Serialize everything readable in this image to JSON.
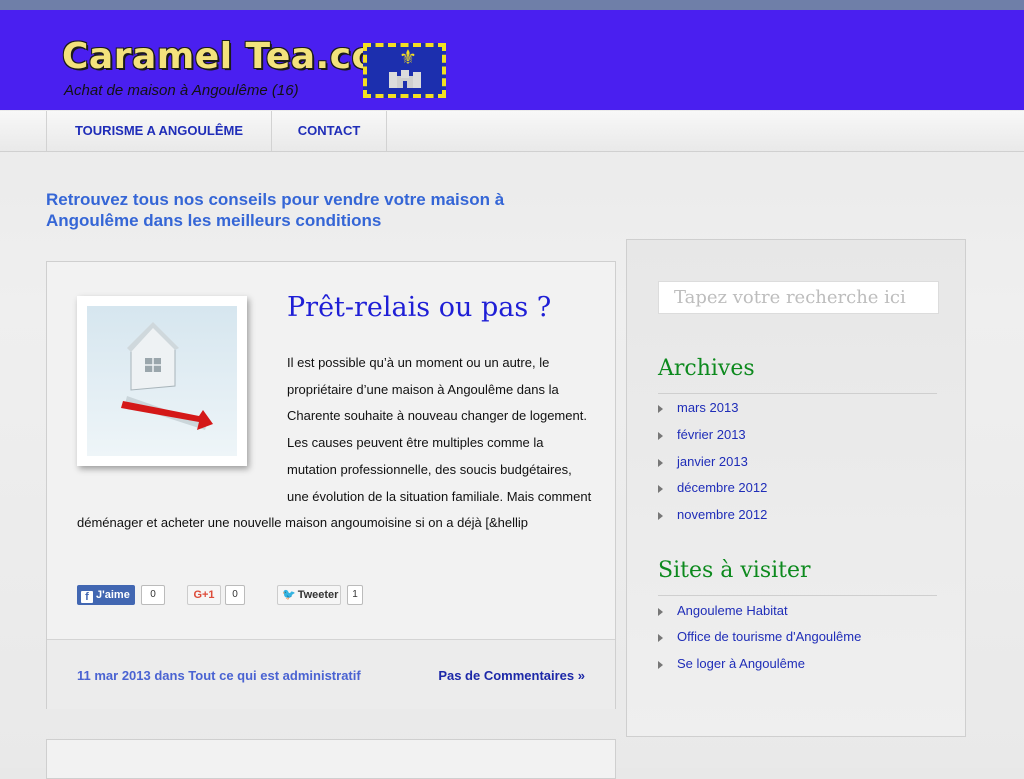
{
  "header": {
    "site_title": "Caramel Tea.com",
    "site_subtitle": "Achat de maison à Angoulême (16)",
    "flag_icon": "fleur-de-lis-castle-flag"
  },
  "nav": {
    "items": [
      "TOURISME A ANGOULÊME",
      "CONTACT"
    ]
  },
  "tagline": "Retrouvez tous nos conseils pour vendre votre maison à Angoulême dans les meilleurs conditions",
  "post": {
    "title": "Prêt-relais ou pas ?",
    "body": "Il est possible qu’à un moment ou un autre, le propriétaire d’une maison à Angoulême dans la Charente souhaite à nouveau changer de logement. Les causes peuvent être multiples comme la mutation professionnelle, des soucis budgétaires, une évolution de la situation familiale. Mais comment déménager et acheter une nouvelle maison angoumoisine si on a déjà [&hellip",
    "share": {
      "facebook_label": "J'aime",
      "facebook_count": "0",
      "gplus_label": "G+1",
      "gplus_count": "0",
      "twitter_label": "Tweeter",
      "twitter_count": "1"
    },
    "meta": "11 mar 2013 dans Tout ce qui est administratif",
    "comments": "Pas de Commentaires »"
  },
  "sidebar": {
    "search_placeholder": "Tapez votre recherche ici",
    "archives_title": "Archives",
    "archives": [
      "mars 2013",
      "février 2013",
      "janvier 2013",
      "décembre 2012",
      "novembre 2012"
    ],
    "sites_title": "Sites à visiter",
    "sites": [
      "Angouleme Habitat",
      "Office de tourisme d'Angoulême",
      "Se loger à Angoulême"
    ]
  },
  "colors": {
    "header_bg": "#4a1ff0",
    "link": "#1f2db8",
    "widget_title": "#0d8a1e",
    "tagline": "#3566d6"
  }
}
